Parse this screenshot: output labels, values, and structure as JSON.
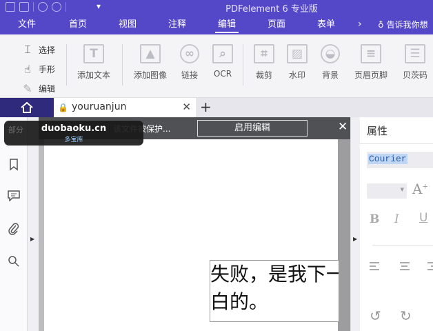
{
  "app": {
    "title": "PDFelement 6 专业版"
  },
  "menu": {
    "items": [
      "文件",
      "首页",
      "视图",
      "注释",
      "编辑",
      "页面",
      "表单"
    ],
    "active": "编辑",
    "tell_me": "告诉我你想"
  },
  "ribbon": {
    "modes": {
      "select": "选择",
      "hand": "手形",
      "edit": "编辑"
    },
    "tools": {
      "add_text": "添加文本",
      "add_image": "添加图像",
      "link": "链接",
      "ocr": "OCR",
      "crop": "裁剪",
      "watermark": "水印",
      "background": "背景",
      "header_footer": "页眉页脚",
      "bates": "贝茨码"
    }
  },
  "tabs": {
    "doc_name": "youruanjun"
  },
  "banner": {
    "message": "该文件被保护...",
    "enable_button": "启用编辑"
  },
  "watermark": {
    "line1": "duobaoku.cn",
    "line2": "多宝库",
    "ghost": "部分"
  },
  "document": {
    "line1": "失败，是我下一",
    "line2": "白的。"
  },
  "properties": {
    "title": "属性",
    "font_name": "Courier",
    "bold": "B",
    "italic": "I",
    "underline": "U",
    "grow": "A"
  }
}
